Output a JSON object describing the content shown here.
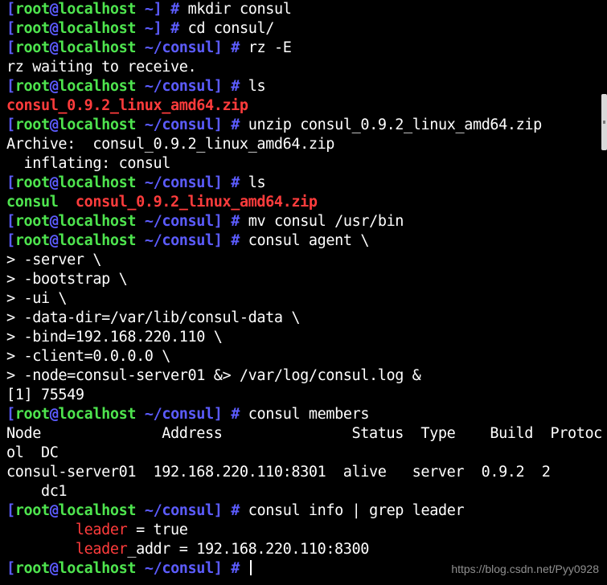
{
  "prompt": {
    "user": "root",
    "at": "@",
    "host": "localhost",
    "cwd_home": "~",
    "cwd_consul": "~/consul",
    "symbol": "#"
  },
  "lines": [
    {
      "cmd": "mkdir consul"
    },
    {
      "cmd": "cd consul/"
    },
    {
      "cmd": "rz -E"
    },
    {
      "out": "rz waiting to receive."
    },
    {
      "cmd": "ls"
    },
    {
      "out": "consul_0.9.2_linux_amd64.zip"
    },
    {
      "cmd": "unzip consul_0.9.2_linux_amd64.zip"
    },
    {
      "out": "Archive:  consul_0.9.2_linux_amd64.zip"
    },
    {
      "out": "  inflating: consul"
    },
    {
      "cmd": "ls"
    },
    {
      "out_a": "consul",
      "out_b": "consul_0.9.2_linux_amd64.zip"
    },
    {
      "cmd": "mv consul /usr/bin"
    },
    {
      "cmd": "consul agent \\"
    },
    {
      "out": "> -server \\"
    },
    {
      "out": "> -bootstrap \\"
    },
    {
      "out": "> -ui \\"
    },
    {
      "out": "> -data-dir=/var/lib/consul-data \\"
    },
    {
      "out": "> -bind=192.168.220.110 \\"
    },
    {
      "out": "> -client=0.0.0.0 \\"
    },
    {
      "out": "> -node=consul-server01 &> /var/log/consul.log &"
    },
    {
      "out": "[1] 75549"
    },
    {
      "cmd": "consul members"
    },
    {
      "out": "Node              Address               Status  Type    Build  Protoc"
    },
    {
      "out": "ol  DC"
    },
    {
      "out": "consul-server01  192.168.220.110:8301  alive   server  0.9.2  2"
    },
    {
      "out": "    dc1"
    },
    {
      "cmd_a": "consul info | grep ",
      "cmd_b": "leader"
    },
    {
      "indent": "        ",
      "key": "leader",
      "rest": " = true"
    },
    {
      "indent": "        ",
      "key": "leader",
      "rest": "_addr = 192.168.220.110:8300"
    },
    {
      "cmd": ""
    }
  ],
  "watermark": "https://blog.csdn.net/Pyy0928",
  "colors": {
    "background": "#000000",
    "foreground": "#ffffff",
    "prompt_bracket_path": "#5c5cff",
    "prompt_user_host": "#4ee44e",
    "archive_file": "#ff3c3c",
    "directory_exec": "#4ee44e",
    "grep_match": "#ff3c3c"
  }
}
